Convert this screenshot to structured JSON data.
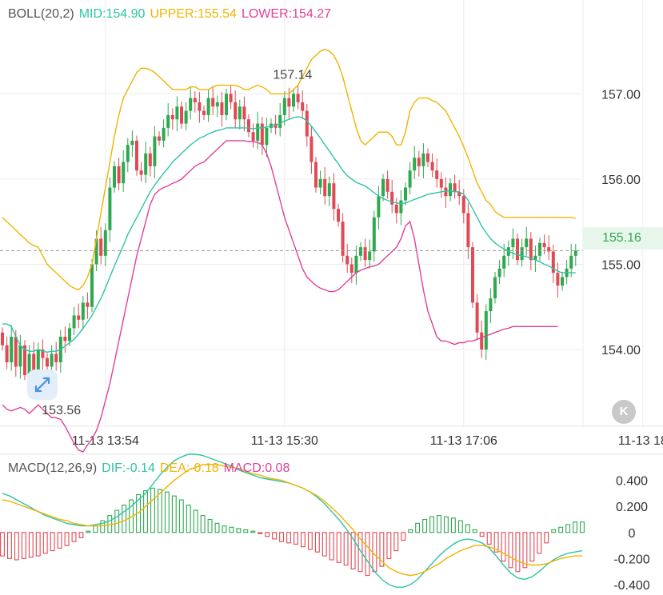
{
  "boll_legend": {
    "name": "BOLL(20,2)",
    "mid": "MID:154.90",
    "upper": "UPPER:155.54",
    "lower": "LOWER:154.27"
  },
  "macd_legend": {
    "name": "MACD(12,26,9)",
    "dif": "DIF:-0.14",
    "dea": "DEA:-0.18",
    "macd": "MACD:0.08"
  },
  "colors": {
    "mid": "#2ec4a6",
    "upper": "#f0b400",
    "lower": "#e0409a",
    "up": "#2fa84f",
    "down": "#e04a54",
    "grid": "#ececec",
    "axis_text": "#333333",
    "muted": "#888888"
  },
  "current_price": "155.16",
  "high_label": "157.14",
  "low_label": "153.56",
  "back_icon_glyph": "K",
  "chart_data": [
    {
      "type": "candlestick",
      "title": "BOLL(20,2)",
      "y_ticks": [
        "157.00",
        "156.00",
        "155.00",
        "154.00"
      ],
      "y_tick_values": [
        157,
        156,
        155,
        154
      ],
      "ylim": [
        153.1,
        158.1
      ],
      "x_ticks": [
        "11-13 13:54",
        "11-13 15:30",
        "11-13 17:06",
        "11-13 18"
      ],
      "x_tick_index": [
        23,
        63,
        103,
        143
      ],
      "current_price": 155.16,
      "annotations": [
        {
          "text": "157.14",
          "index": 64,
          "value": 157.14
        },
        {
          "text": "153.56",
          "index": 7,
          "value": 153.56
        }
      ],
      "closes": [
        154.05,
        153.85,
        154.15,
        153.8,
        154.05,
        153.7,
        153.95,
        153.75,
        154.0,
        153.9,
        153.8,
        153.95,
        153.85,
        154.15,
        154.1,
        154.25,
        154.4,
        154.35,
        154.55,
        154.5,
        155.0,
        155.3,
        155.1,
        155.4,
        155.9,
        156.15,
        155.95,
        156.2,
        156.4,
        156.45,
        156.1,
        156.05,
        156.3,
        156.15,
        156.5,
        156.45,
        156.6,
        156.75,
        156.7,
        156.85,
        156.65,
        156.8,
        156.95,
        156.9,
        156.8,
        156.75,
        156.95,
        156.85,
        156.9,
        156.75,
        157.0,
        156.9,
        156.7,
        156.85,
        156.7,
        156.55,
        156.45,
        156.65,
        156.4,
        156.6,
        156.65,
        156.6,
        156.75,
        156.95,
        156.85,
        157.0,
        156.9,
        156.8,
        156.5,
        156.2,
        155.9,
        156.0,
        155.8,
        155.95,
        155.65,
        155.5,
        155.1,
        155.0,
        154.9,
        155.1,
        155.2,
        155.05,
        155.15,
        155.55,
        155.8,
        156.0,
        155.85,
        155.7,
        155.6,
        155.75,
        155.9,
        156.1,
        156.25,
        156.15,
        156.3,
        156.2,
        156.1,
        156.0,
        155.9,
        155.8,
        155.95,
        155.85,
        155.8,
        155.6,
        155.2,
        154.55,
        154.2,
        154.0,
        154.45,
        154.6,
        154.85,
        154.95,
        155.1,
        155.2,
        155.3,
        155.05,
        155.2,
        155.3,
        155.05,
        155.1,
        155.25,
        155.2,
        155.15,
        154.9,
        154.75,
        154.85,
        154.95,
        155.1,
        155.16
      ],
      "series": [
        {
          "name": "MID",
          "values": [
            154.3,
            154.3,
            154.27,
            154.15,
            154.05,
            154.0,
            153.98,
            153.98,
            154.0,
            153.98,
            153.97,
            153.98,
            153.98,
            154.0,
            154.04,
            154.08,
            154.12,
            154.18,
            154.25,
            154.32,
            154.4,
            154.5,
            154.6,
            154.72,
            154.85,
            154.98,
            155.1,
            155.22,
            155.35,
            155.45,
            155.55,
            155.65,
            155.75,
            155.85,
            155.93,
            156.0,
            156.07,
            156.13,
            156.2,
            156.25,
            156.3,
            156.35,
            156.4,
            156.44,
            156.48,
            156.5,
            156.53,
            156.55,
            156.57,
            156.58,
            156.6,
            156.6,
            156.6,
            156.6,
            156.6,
            156.6,
            156.59,
            156.6,
            156.6,
            156.61,
            156.62,
            156.63,
            156.65,
            156.68,
            156.7,
            156.72,
            156.73,
            156.72,
            156.68,
            156.62,
            156.55,
            156.48,
            156.4,
            156.33,
            156.25,
            156.18,
            156.1,
            156.04,
            156.0,
            155.96,
            155.94,
            155.92,
            155.88,
            155.84,
            155.8,
            155.77,
            155.75,
            155.73,
            155.72,
            155.71,
            155.72,
            155.74,
            155.76,
            155.78,
            155.8,
            155.82,
            155.83,
            155.84,
            155.85,
            155.86,
            155.86,
            155.85,
            155.85,
            155.82,
            155.75,
            155.65,
            155.55,
            155.45,
            155.37,
            155.3,
            155.25,
            155.21,
            155.18,
            155.15,
            155.13,
            155.11,
            155.1,
            155.09,
            155.07,
            155.05,
            155.03,
            155.0,
            154.98,
            154.95,
            154.92,
            154.9,
            154.9,
            154.9,
            154.9
          ]
        },
        {
          "name": "UPPER",
          "values": [
            155.55,
            155.5,
            155.45,
            155.4,
            155.35,
            155.3,
            155.25,
            155.22,
            155.2,
            155.1,
            155.0,
            154.95,
            154.9,
            154.85,
            154.8,
            154.75,
            154.72,
            154.7,
            154.75,
            154.85,
            155.0,
            155.3,
            155.6,
            155.9,
            156.2,
            156.5,
            156.75,
            156.95,
            157.05,
            157.15,
            157.25,
            157.3,
            157.3,
            157.28,
            157.25,
            157.2,
            157.15,
            157.1,
            157.05,
            157.05,
            157.05,
            157.05,
            157.08,
            157.08,
            157.05,
            157.05,
            157.05,
            157.08,
            157.1,
            157.1,
            157.1,
            157.1,
            157.1,
            157.08,
            157.05,
            157.05,
            157.08,
            157.1,
            157.08,
            157.05,
            157.0,
            157.0,
            157.0,
            157.0,
            157.0,
            157.05,
            157.1,
            157.2,
            157.3,
            157.4,
            157.45,
            157.5,
            157.52,
            157.5,
            157.45,
            157.35,
            157.2,
            157.0,
            156.8,
            156.6,
            156.45,
            156.4,
            156.45,
            156.5,
            156.55,
            156.55,
            156.55,
            156.5,
            156.4,
            156.4,
            156.55,
            156.8,
            156.9,
            156.95,
            156.95,
            156.95,
            156.92,
            156.9,
            156.85,
            156.8,
            156.7,
            156.6,
            156.5,
            156.38,
            156.25,
            156.1,
            155.95,
            155.85,
            155.75,
            155.7,
            155.62,
            155.58,
            155.55,
            155.55,
            155.55,
            155.55,
            155.55,
            155.55,
            155.55,
            155.55,
            155.55,
            155.55,
            155.55,
            155.55,
            155.55,
            155.55,
            155.55,
            155.55,
            155.54
          ]
        },
        {
          "name": "LOWER",
          "values": [
            153.35,
            153.3,
            153.28,
            153.3,
            153.32,
            153.3,
            153.25,
            153.3,
            153.35,
            153.3,
            153.25,
            153.2,
            153.2,
            153.18,
            153.1,
            153.0,
            152.9,
            152.82,
            152.8,
            152.88,
            152.95,
            153.05,
            153.2,
            153.4,
            153.6,
            153.85,
            154.1,
            154.35,
            154.6,
            154.85,
            155.1,
            155.3,
            155.5,
            155.7,
            155.82,
            155.87,
            155.9,
            155.92,
            155.95,
            155.97,
            156.0,
            156.05,
            156.1,
            156.15,
            156.18,
            156.2,
            156.25,
            156.3,
            156.35,
            156.4,
            156.45,
            156.45,
            156.45,
            156.45,
            156.45,
            156.44,
            156.44,
            156.43,
            156.4,
            156.3,
            156.15,
            155.95,
            155.75,
            155.55,
            155.4,
            155.25,
            155.1,
            154.95,
            154.85,
            154.8,
            154.75,
            154.72,
            154.7,
            154.68,
            154.68,
            154.7,
            154.75,
            154.8,
            154.85,
            154.9,
            154.93,
            154.95,
            154.97,
            154.98,
            155.0,
            155.05,
            155.1,
            155.15,
            155.2,
            155.3,
            155.45,
            155.5,
            155.3,
            155.0,
            154.7,
            154.45,
            154.3,
            154.15,
            154.1,
            154.1,
            154.08,
            154.06,
            154.08,
            154.08,
            154.1,
            154.1,
            154.12,
            154.14,
            154.16,
            154.18,
            154.2,
            154.22,
            154.24,
            154.25,
            154.27,
            154.27,
            154.27,
            154.27,
            154.27,
            154.27,
            154.27,
            154.27,
            154.27,
            154.27,
            154.27
          ]
        }
      ]
    },
    {
      "type": "bar",
      "title": "MACD(12,26,9)",
      "y_ticks": [
        "0.400",
        "0.200",
        "0",
        "-0.200",
        "-0.400"
      ],
      "y_tick_values": [
        0.4,
        0.2,
        0,
        -0.2,
        -0.4
      ],
      "ylim": [
        -0.48,
        0.6
      ],
      "series": [
        {
          "name": "DIF",
          "values": [
            0.3,
            0.28,
            0.25,
            0.22,
            0.19,
            0.16,
            0.13,
            0.11,
            0.09,
            0.07,
            0.06,
            0.05,
            0.05,
            0.06,
            0.07,
            0.09,
            0.12,
            0.16,
            0.2,
            0.25,
            0.3,
            0.37,
            0.44,
            0.5,
            0.55,
            0.58,
            0.6,
            0.6,
            0.59,
            0.57,
            0.55,
            0.53,
            0.51,
            0.48,
            0.46,
            0.44,
            0.42,
            0.41,
            0.4,
            0.39,
            0.38,
            0.36,
            0.34,
            0.31,
            0.27,
            0.22,
            0.16,
            0.1,
            0.03,
            -0.05,
            -0.14,
            -0.22,
            -0.3,
            -0.36,
            -0.4,
            -0.42,
            -0.42,
            -0.4,
            -0.36,
            -0.3,
            -0.24,
            -0.18,
            -0.13,
            -0.09,
            -0.06,
            -0.05,
            -0.06,
            -0.08,
            -0.12,
            -0.18,
            -0.25,
            -0.31,
            -0.35,
            -0.36,
            -0.34,
            -0.3,
            -0.25,
            -0.21,
            -0.18,
            -0.16,
            -0.15,
            -0.14
          ]
        },
        {
          "name": "DEA",
          "values": [
            0.25,
            0.24,
            0.22,
            0.2,
            0.18,
            0.16,
            0.14,
            0.12,
            0.1,
            0.09,
            0.07,
            0.06,
            0.05,
            0.05,
            0.05,
            0.06,
            0.07,
            0.09,
            0.12,
            0.15,
            0.2,
            0.25,
            0.3,
            0.35,
            0.4,
            0.44,
            0.48,
            0.5,
            0.52,
            0.52,
            0.52,
            0.51,
            0.5,
            0.49,
            0.47,
            0.45,
            0.44,
            0.42,
            0.41,
            0.4,
            0.38,
            0.36,
            0.34,
            0.31,
            0.28,
            0.24,
            0.19,
            0.14,
            0.08,
            0.02,
            -0.05,
            -0.11,
            -0.17,
            -0.22,
            -0.27,
            -0.3,
            -0.32,
            -0.33,
            -0.32,
            -0.3,
            -0.27,
            -0.24,
            -0.2,
            -0.17,
            -0.14,
            -0.12,
            -0.1,
            -0.1,
            -0.11,
            -0.13,
            -0.16,
            -0.19,
            -0.22,
            -0.24,
            -0.25,
            -0.25,
            -0.24,
            -0.22,
            -0.2,
            -0.19,
            -0.18,
            -0.18
          ]
        },
        {
          "name": "MACD",
          "values": [
            -0.18,
            -0.2,
            -0.21,
            -0.2,
            -0.19,
            -0.18,
            -0.16,
            -0.14,
            -0.12,
            -0.1,
            -0.07,
            -0.04,
            0.01,
            0.05,
            0.09,
            0.13,
            0.17,
            0.21,
            0.25,
            0.29,
            0.32,
            0.34,
            0.33,
            0.31,
            0.28,
            0.25,
            0.21,
            0.17,
            0.13,
            0.1,
            0.07,
            0.05,
            0.04,
            0.03,
            0.02,
            0.01,
            -0.01,
            -0.03,
            -0.05,
            -0.07,
            -0.08,
            -0.09,
            -0.11,
            -0.13,
            -0.15,
            -0.18,
            -0.21,
            -0.23,
            -0.25,
            -0.28,
            -0.3,
            -0.33,
            -0.3,
            -0.26,
            -0.2,
            -0.14,
            -0.06,
            0.02,
            0.07,
            0.1,
            0.12,
            0.13,
            0.12,
            0.11,
            0.09,
            0.06,
            0.02,
            -0.03,
            -0.09,
            -0.15,
            -0.22,
            -0.27,
            -0.3,
            -0.27,
            -0.22,
            -0.16,
            -0.08,
            0.02,
            0.04,
            0.06,
            0.08,
            0.08
          ]
        }
      ]
    }
  ]
}
